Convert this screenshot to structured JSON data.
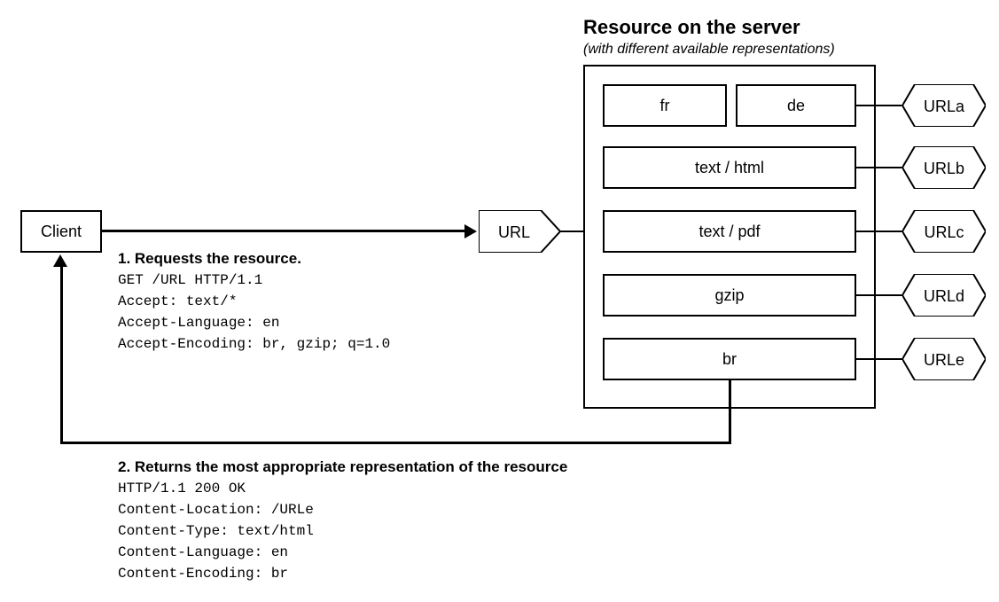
{
  "client_label": "Client",
  "server_title": "Resource on the server",
  "server_subtitle": "(with different available representations)",
  "url_label": "URL",
  "representations": {
    "lang_fr": "fr",
    "lang_de": "de",
    "type_html": "text / html",
    "type_pdf": "text / pdf",
    "enc_gzip": "gzip",
    "enc_br": "br"
  },
  "url_tags": {
    "a": "URLa",
    "b": "URLb",
    "c": "URLc",
    "d": "URLd",
    "e": "URLe"
  },
  "request": {
    "heading": "1. Requests the resource.",
    "lines": "GET /URL HTTP/1.1\nAccept: text/*\nAccept-Language: en\nAccept-Encoding: br, gzip; q=1.0"
  },
  "response": {
    "heading": "2. Returns the most appropriate representation of the resource",
    "lines": "HTTP/1.1 200 OK\nContent-Location: /URLe\nContent-Type: text/html\nContent-Language: en\nContent-Encoding: br"
  }
}
